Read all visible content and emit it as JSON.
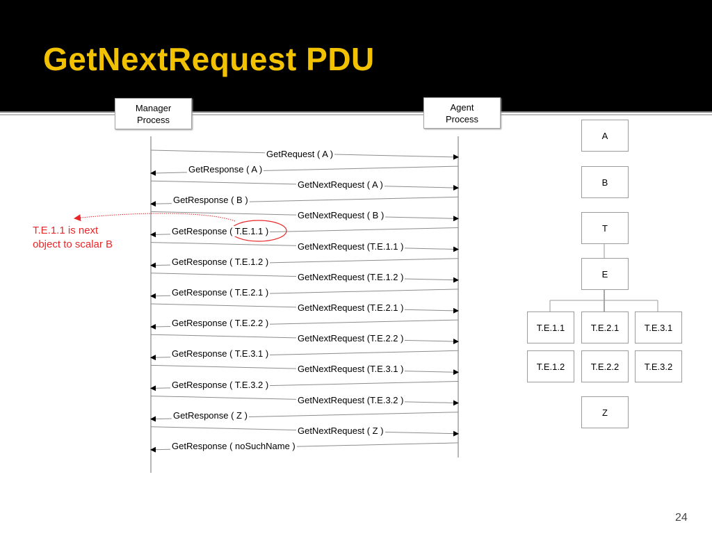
{
  "slide": {
    "title": "GetNextRequest PDU",
    "page_number": "24",
    "colors": {
      "title": "#f2c200",
      "header_bg": "#000000",
      "annotation": "#e8262a"
    }
  },
  "processes": {
    "manager": "Manager\nProcess",
    "agent": "Agent\nProcess"
  },
  "messages": [
    {
      "dir": "request",
      "label": "GetRequest ( A )"
    },
    {
      "dir": "response",
      "label": "GetResponse ( A )"
    },
    {
      "dir": "request",
      "label": "GetNextRequest ( A )"
    },
    {
      "dir": "response",
      "label": "GetResponse ( B )"
    },
    {
      "dir": "request",
      "label": "GetNextRequest ( B )"
    },
    {
      "dir": "response",
      "label": "GetResponse ( T.E.1.1 )"
    },
    {
      "dir": "request",
      "label": "GetNextRequest (T.E.1.1 )"
    },
    {
      "dir": "response",
      "label": "GetResponse ( T.E.1.2 )"
    },
    {
      "dir": "request",
      "label": "GetNextRequest (T.E.1.2 )"
    },
    {
      "dir": "response",
      "label": "GetResponse ( T.E.2.1 )"
    },
    {
      "dir": "request",
      "label": "GetNextRequest (T.E.2.1 )"
    },
    {
      "dir": "response",
      "label": "GetResponse ( T.E.2.2 )"
    },
    {
      "dir": "request",
      "label": "GetNextRequest (T.E.2.2 )"
    },
    {
      "dir": "response",
      "label": "GetResponse ( T.E.3.1 )"
    },
    {
      "dir": "request",
      "label": "GetNextRequest (T.E.3.1 )"
    },
    {
      "dir": "response",
      "label": "GetResponse ( T.E.3.2 )"
    },
    {
      "dir": "request",
      "label": "GetNextRequest (T.E.3.2 )"
    },
    {
      "dir": "response",
      "label": "GetResponse ( Z )"
    },
    {
      "dir": "request",
      "label": "GetNextRequest ( Z )"
    },
    {
      "dir": "response",
      "label": "GetResponse ( noSuchName )"
    }
  ],
  "annotation": {
    "text_line1": "T.E.1.1 is next",
    "text_line2": "object to scalar B",
    "highlighted_message": "GetResponse ( T.E.1.1 )"
  },
  "tree": {
    "nodes": {
      "A": "A",
      "B": "B",
      "T": "T",
      "E": "E",
      "TE11": "T.E.1.1",
      "TE21": "T.E.2.1",
      "TE31": "T.E.3.1",
      "TE12": "T.E.1.2",
      "TE22": "T.E.2.2",
      "TE32": "T.E.3.2",
      "Z": "Z"
    }
  }
}
